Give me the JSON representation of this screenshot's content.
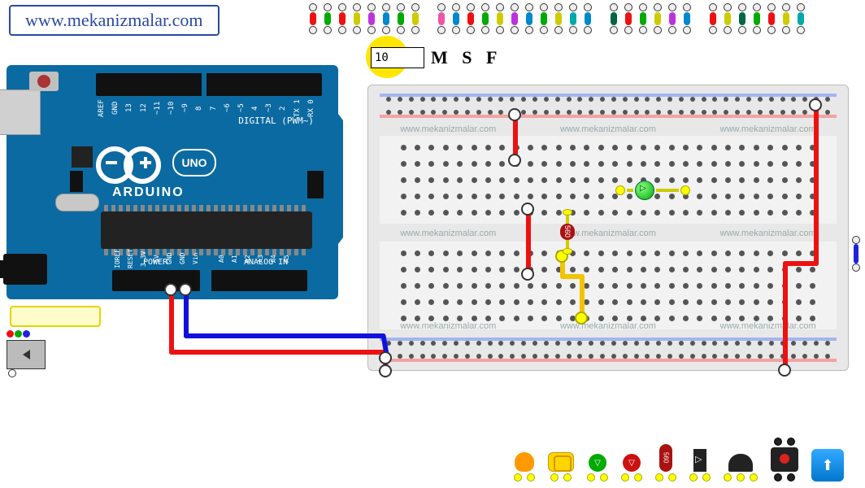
{
  "site_url": "www.mekanizmalar.com",
  "speed": {
    "value": "10",
    "label": "M S F"
  },
  "wire_colors": [
    "#e11",
    "#0a0",
    "#e11",
    "#cc0",
    "#b3d",
    "#08c",
    "#0a0",
    "#cc0",
    "#e5a",
    "#08c",
    "#e11",
    "#0a0",
    "#cc0",
    "#b3d",
    "#08c",
    "#0a0",
    "#cc0",
    "#0aa",
    "#08c",
    "#064",
    "#e11",
    "#0a0",
    "#cc0",
    "#b3d",
    "#08c",
    "#e11",
    "#cc0",
    "#064",
    "#0a0",
    "#e11",
    "#cc0",
    "#0aa"
  ],
  "arduino": {
    "name": "ARDUINO",
    "model": "UNO",
    "digital_label": "DIGITAL (PWM~)",
    "power_label": "POWER",
    "analog_label": "ANALOG IN",
    "top_pins": [
      "AREF",
      "GND",
      "13",
      "12",
      "~11",
      "~10",
      "~9",
      "8",
      "7",
      "~6",
      "~5",
      "4",
      "~3",
      "2",
      "TX 1",
      "RX 0"
    ],
    "bottom_pins": [
      "IOREF",
      "RESET",
      "3.3V",
      "5V",
      "GND",
      "GND",
      "Vin",
      "",
      "A0",
      "A1",
      "A2",
      "A3",
      "A4",
      "A5"
    ]
  },
  "breadboard": {
    "watermark": "www.mekanizmalar.com",
    "resistor_value": "560"
  },
  "components": {
    "resistor_label": "560"
  }
}
